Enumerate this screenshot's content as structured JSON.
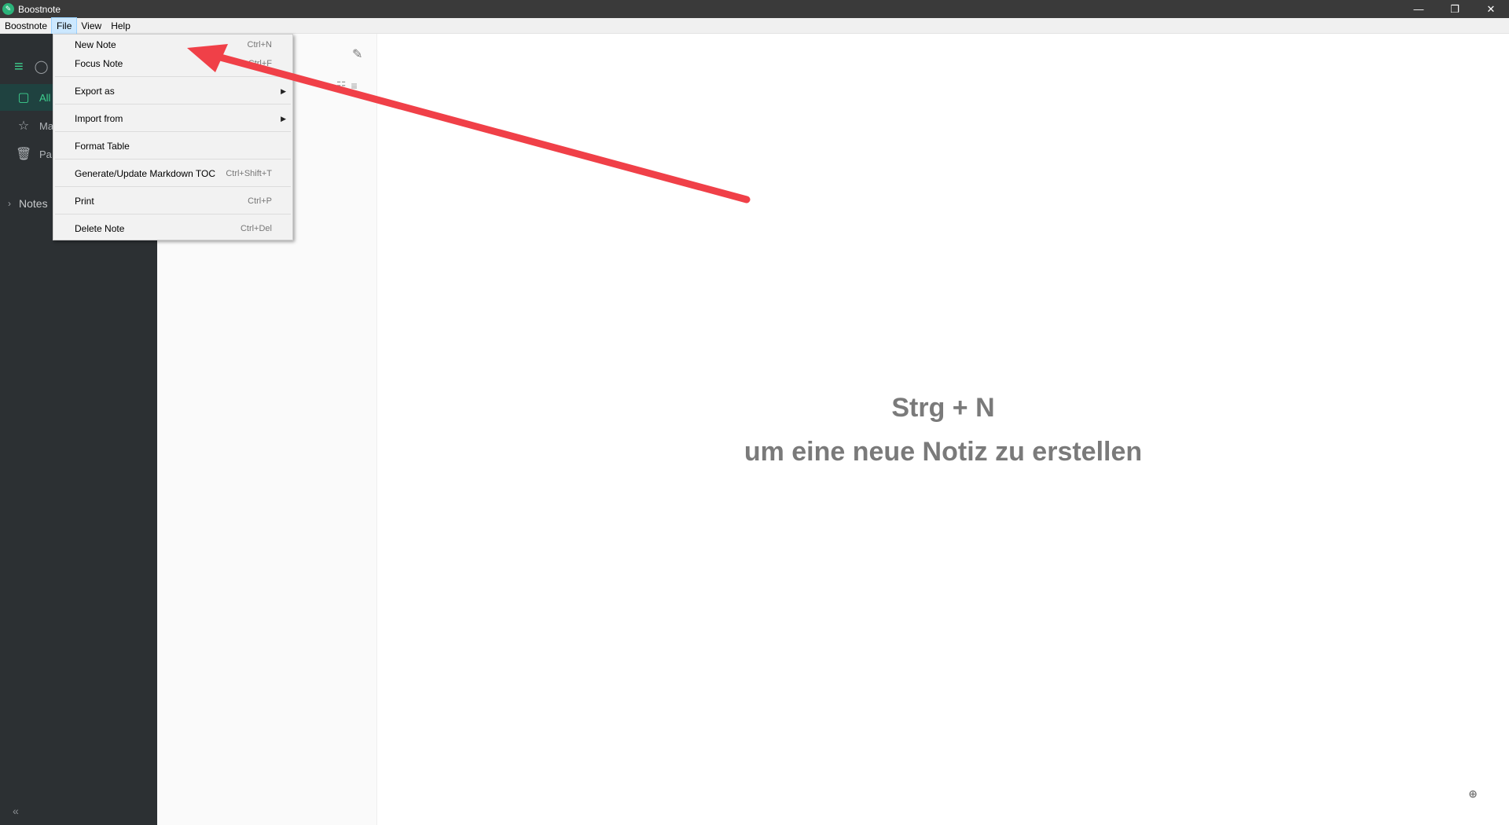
{
  "window": {
    "title": "Boostnote"
  },
  "menubar": {
    "items": [
      "Boostnote",
      "File",
      "View",
      "Help"
    ]
  },
  "file_menu": {
    "new_note": "New Note",
    "new_note_accel": "Ctrl+N",
    "focus_note": "Focus Note",
    "focus_note_accel": "Ctrl+F",
    "export_as": "Export as",
    "import_from": "Import from",
    "format_table": "Format Table",
    "generate_toc": "Generate/Update Markdown TOC",
    "generate_toc_accel": "Ctrl+Shift+T",
    "print": "Print",
    "print_accel": "Ctrl+P",
    "delete_note": "Delete Note",
    "delete_note_accel": "Ctrl+Del"
  },
  "sidebar": {
    "items": [
      {
        "label": "All",
        "icon": "book-icon"
      },
      {
        "label": "Ma",
        "icon": "star-icon"
      },
      {
        "label": "Pa",
        "icon": "trash-icon"
      }
    ],
    "notes_label": "Notes",
    "collapse_glyph": "«"
  },
  "main": {
    "hint_line1": "Strg + N",
    "hint_line2": "um eine neue Notiz zu erstellen"
  },
  "colors": {
    "accent": "#3ecf8e",
    "sidebar_bg": "#2c3033",
    "annotation_arrow": "#f04048"
  }
}
